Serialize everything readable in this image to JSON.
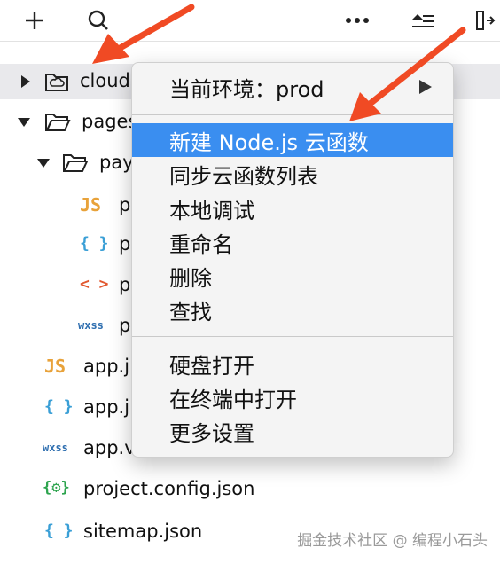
{
  "toolbar": {
    "icons": [
      "add-icon",
      "search-icon",
      "more-icon",
      "collapse-icon",
      "split-icon"
    ]
  },
  "tree": [
    {
      "label": "cloud",
      "icon": "cloud-folder-icon",
      "expanded": false,
      "selected": true
    },
    {
      "label": "pages",
      "icon": "folder-icon",
      "expanded": true
    },
    {
      "label": "pay",
      "icon": "folder-icon",
      "expanded": true
    },
    {
      "label": "p",
      "icon": "js-file-icon",
      "icon_text": "JS"
    },
    {
      "label": "p",
      "icon": "json-file-icon",
      "icon_text": "{ }"
    },
    {
      "label": "p",
      "icon": "html-file-icon",
      "icon_text": "< >"
    },
    {
      "label": "p",
      "icon": "wxss-file-icon",
      "icon_text": "wxss"
    },
    {
      "label": "app.j",
      "icon": "js-file-icon",
      "icon_text": "JS"
    },
    {
      "label": "app.j",
      "icon": "json-file-icon",
      "icon_text": "{ }"
    },
    {
      "label": "app.v",
      "icon": "wxss-file-icon",
      "icon_text": "wxss"
    },
    {
      "label": "project.config.json",
      "icon": "config-file-icon",
      "icon_text": "{⚙}"
    },
    {
      "label": "sitemap.json",
      "icon": "json-file-icon",
      "icon_text": "{ }"
    }
  ],
  "context_menu": {
    "env_label": "当前环境：prod",
    "items": [
      "新建 Node.js 云函数",
      "同步云函数列表",
      "本地调试",
      "重命名",
      "删除",
      "查找"
    ],
    "items2": [
      "硬盘打开",
      "在终端中打开",
      "更多设置"
    ]
  },
  "watermark": "掘金技术社区 @ 编程小石头",
  "colors": {
    "highlight": "#3a8ef0",
    "annotation_arrow": "#f04a24",
    "js_icon": "#e8a23a",
    "json_icon": "#3a9fd6",
    "html_icon": "#e2572e",
    "wxss_icon": "#2f6fb0",
    "config_icon": "#2da44e"
  }
}
